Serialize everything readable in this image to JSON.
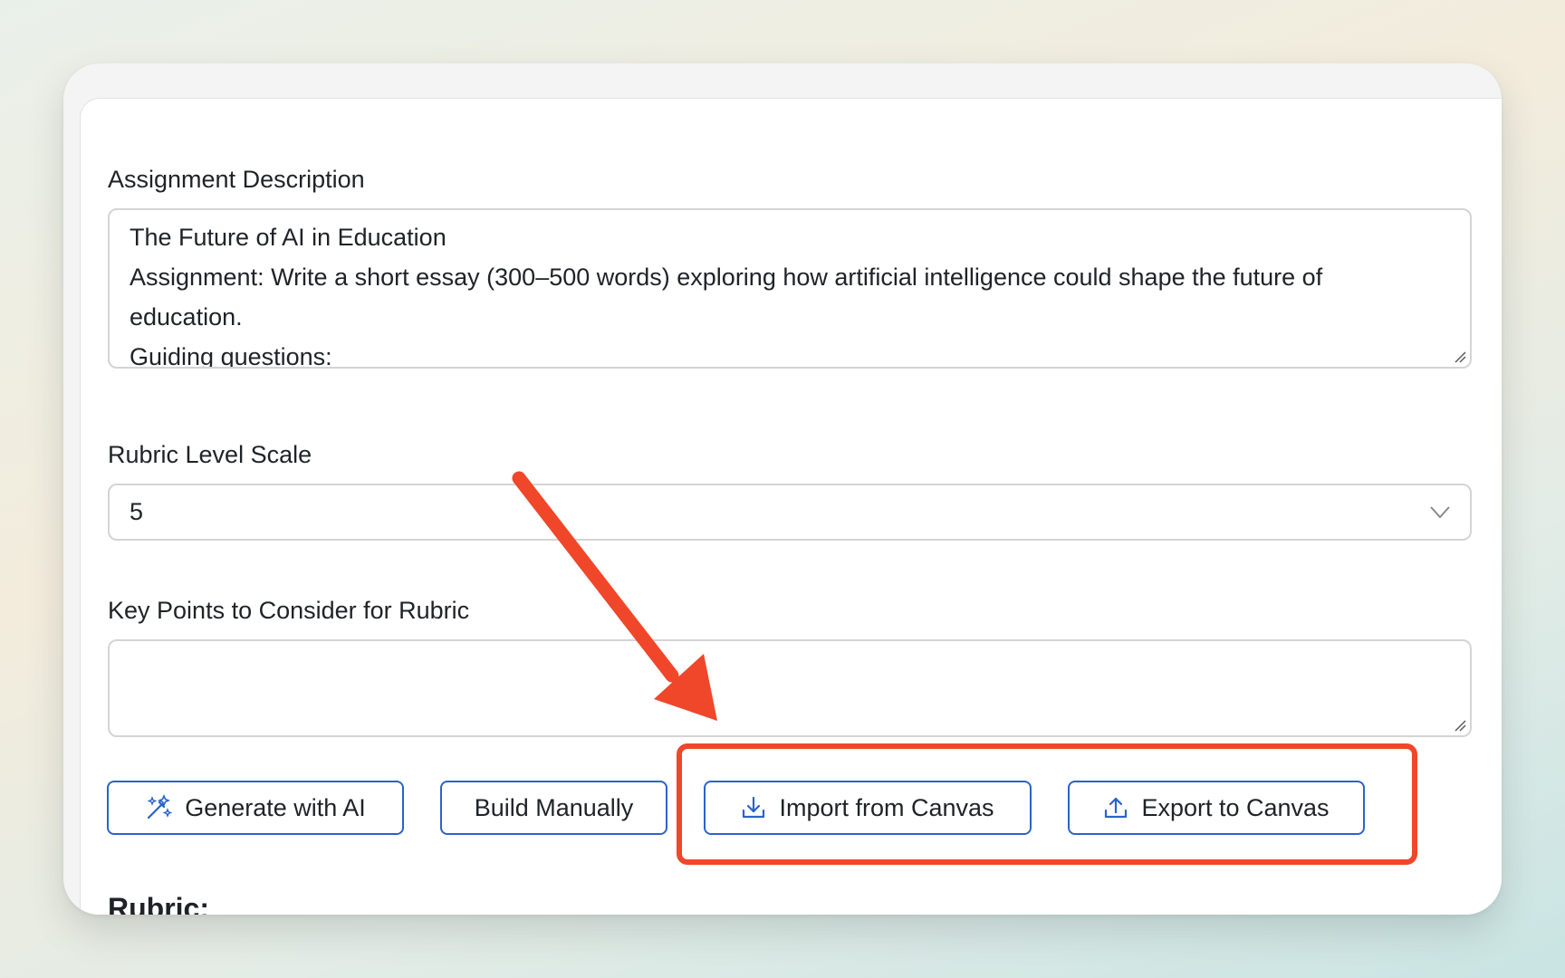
{
  "form": {
    "assignment_label": "Assignment Description",
    "assignment_lines": [
      "The Future of AI in Education",
      "Assignment: Write a short essay (300–500 words) exploring how artificial intelligence could shape the future of",
      "education.",
      "Guiding questions:"
    ],
    "scale_label": "Rubric Level Scale",
    "scale_value": "5",
    "keypoints_label": "Key Points to Consider for Rubric",
    "keypoints_value": ""
  },
  "actions": {
    "generate_label": "Generate with AI",
    "build_label": "Build Manually",
    "import_label": "Import from Canvas",
    "export_label": "Export to Canvas"
  },
  "rubric": {
    "heading": "Rubric:"
  },
  "icons": {
    "generate": "magic-wand-icon",
    "import": "download-tray-icon",
    "export": "upload-tray-icon",
    "select": "chevron-down-icon"
  },
  "colors": {
    "button_border": "#2b63c9",
    "annotation": "#f0462a",
    "field_border": "#d4d4d4"
  }
}
